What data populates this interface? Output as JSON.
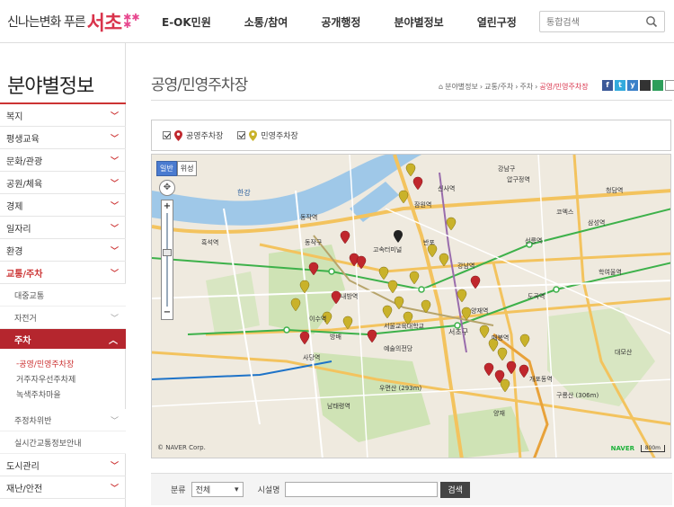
{
  "header": {
    "logo_small": "신나는변화 푸른",
    "logo_big": "서초",
    "nav": [
      "E-OK민원",
      "소통/참여",
      "공개행정",
      "분야별정보",
      "열린구정"
    ],
    "search_placeholder": "통합검색"
  },
  "sidebar": {
    "title": "분야별정보",
    "items_top": [
      "복지",
      "평생교육",
      "문화/관광",
      "공원/체육",
      "경제",
      "일자리",
      "환경"
    ],
    "active": "교통/주차",
    "subs": [
      "대중교통",
      "자전거"
    ],
    "selected": "주차",
    "thirds": [
      "공영/민영주차장",
      "거주자우선주차제",
      "녹색주차마을"
    ],
    "subs_after": [
      "주정차위반",
      "실시간교통정보안내"
    ],
    "items_bottom": [
      "도시관리",
      "재난/안전"
    ]
  },
  "content": {
    "title": "공영/민영주차장",
    "breadcrumb": [
      "분야별정보",
      "교통/주차",
      "주차",
      "공영/민영주차장"
    ],
    "share": [
      "f",
      "t",
      "y",
      "",
      "",
      ""
    ]
  },
  "filters": [
    "공영주차장",
    "민영주차장"
  ],
  "map": {
    "type_buttons": [
      "일반",
      "위성"
    ],
    "zoom_plus": "+",
    "zoom_minus": "−",
    "labels": [
      "강남구",
      "서초구",
      "동작구",
      "한강",
      "반포",
      "양재",
      "우면산 (293m)",
      "구룡산 (306m)",
      "대모산",
      "남태령역",
      "사당역",
      "방배",
      "예술의전당",
      "서울교육대학교",
      "고속터미널",
      "강남역",
      "선릉역",
      "삼성역",
      "코엑스",
      "청담역",
      "학여울역",
      "도곡역",
      "개포동역",
      "양재역",
      "매봉역",
      "잠원역",
      "신사역",
      "압구정역",
      "흑석역",
      "동작역",
      "이수역",
      "내방역"
    ],
    "copyright": "© NAVER Corp.",
    "logo": "NAVER",
    "scale": "800m"
  },
  "search_bar": {
    "category_label": "분류",
    "category_value": "전체",
    "facility_label": "시설명",
    "button": "검색"
  }
}
